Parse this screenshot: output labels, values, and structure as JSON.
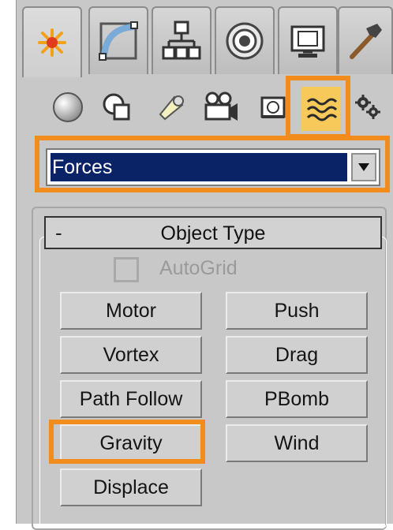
{
  "command_panel": {
    "tabs": [
      {
        "icon": "create-icon",
        "active": true
      },
      {
        "icon": "modify-icon",
        "active": false
      },
      {
        "icon": "hierarchy-icon",
        "active": false
      },
      {
        "icon": "motion-icon",
        "active": false
      },
      {
        "icon": "display-icon",
        "active": false
      },
      {
        "icon": "utilities-icon",
        "active": false
      }
    ],
    "categories": [
      {
        "icon": "geometry-icon",
        "selected": false
      },
      {
        "icon": "shapes-icon",
        "selected": false
      },
      {
        "icon": "lights-icon",
        "selected": false
      },
      {
        "icon": "cameras-icon",
        "selected": false
      },
      {
        "icon": "helpers-icon",
        "selected": false
      },
      {
        "icon": "space-warps-icon",
        "selected": true
      },
      {
        "icon": "systems-icon",
        "selected": false
      }
    ],
    "dropdown": {
      "selected": "Forces"
    },
    "rollout": {
      "collapse_symbol": "-",
      "title": "Object Type",
      "autogrid": {
        "label": "AutoGrid",
        "checked": false,
        "enabled": false
      },
      "buttons": {
        "motor": "Motor",
        "push": "Push",
        "vortex": "Vortex",
        "drag": "Drag",
        "path_follow": "Path Follow",
        "pbomb": "PBomb",
        "gravity": "Gravity",
        "wind": "Wind",
        "displace": "Displace"
      }
    }
  },
  "highlight_color": "#f28c1c",
  "selection_color": "#0a2266"
}
